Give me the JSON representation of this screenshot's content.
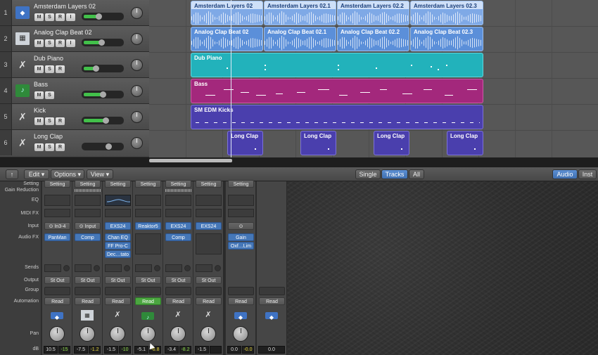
{
  "tracks": [
    {
      "num": "1",
      "name": "Amsterdam Layers 02",
      "icon": "waveform-icon",
      "buttons": [
        "M",
        "S",
        "R",
        "I"
      ]
    },
    {
      "num": "2",
      "name": "Analog Clap Beat 02",
      "icon": "drum-machine-icon",
      "buttons": [
        "M",
        "S",
        "R",
        "I"
      ]
    },
    {
      "num": "3",
      "name": "Dub Piano",
      "icon": "instrument-icon",
      "buttons": [
        "M",
        "S",
        "R"
      ]
    },
    {
      "num": "4",
      "name": "Bass",
      "icon": "midi-region-icon",
      "buttons": [
        "M",
        "S"
      ]
    },
    {
      "num": "5",
      "name": "Kick",
      "icon": "instrument-icon",
      "buttons": [
        "M",
        "S",
        "R"
      ]
    },
    {
      "num": "6",
      "name": "Long Clap",
      "icon": "instrument-icon",
      "buttons": [
        "M",
        "S",
        "R"
      ]
    }
  ],
  "regions": {
    "track1": [
      "Amsterdam Layers 02",
      "Amsterdam Layers 02.1",
      "Amsterdam Layers 02.2",
      "Amsterdam Layers 02.3"
    ],
    "track2": [
      "Analog Clap Beat 02",
      "Analog Clap Beat 02.1",
      "Analog Clap Beat 02.2",
      "Analog Clap Beat 02.3"
    ],
    "track3": "Dub Piano",
    "track4": "Bass",
    "track5": "SM EDM Kicks",
    "track6": [
      "Long Clap",
      "Long Clap",
      "Long Clap",
      "Long Clap"
    ]
  },
  "toolbar": {
    "edit": "Edit",
    "options": "Options",
    "view": "View",
    "single": "Single",
    "tracks": "Tracks",
    "all": "All",
    "audio": "Audio",
    "inst": "Inst"
  },
  "mixer_labels": {
    "setting": "Setting",
    "gain_reduction": "Gain Reduction",
    "eq": "EQ",
    "midi_fx": "MIDI FX",
    "input": "Input",
    "audio_fx": "Audio FX",
    "sends": "Sends",
    "output": "Output",
    "group": "Group",
    "automation": "Automation",
    "pan": "Pan",
    "db": "dB"
  },
  "strips": [
    {
      "setting": "Setting",
      "input": "In3-4",
      "fx": [
        "PanMan"
      ],
      "output": "St Out",
      "automation": "Read",
      "db": "10.5",
      "peak": "-15"
    },
    {
      "setting": "Setting",
      "input": "Input",
      "fx": [
        "Comp"
      ],
      "output": "St Out",
      "automation": "Read",
      "db": "-7.5",
      "peak": "-1.2"
    },
    {
      "setting": "Setting",
      "input": "EXS24",
      "fx": [
        "Chan EQ",
        "FF Pro-C",
        "Dec…tato"
      ],
      "output": "St Out",
      "automation": "Read",
      "db": "-1.5",
      "peak": "-10"
    },
    {
      "setting": "Setting",
      "input": "Reaktor5",
      "fx": [],
      "output": "St Out",
      "automation": "Read",
      "db": "-5.1",
      "peak": "-6.8"
    },
    {
      "setting": "Setting",
      "input": "EXS24",
      "fx": [
        "Comp"
      ],
      "output": "St Out",
      "automation": "Read",
      "db": "-3.4",
      "peak": "-8.2"
    },
    {
      "setting": "Setting",
      "input": "EXS24",
      "fx": [],
      "output": "St Out",
      "automation": "Read",
      "db": "-1.5",
      "peak": ""
    },
    {
      "setting": "Setting",
      "input": "",
      "fx": [
        "Gain",
        "Oxf…Lim"
      ],
      "output": "",
      "automation": "Read",
      "db": "0.0",
      "peak": "-0.0"
    },
    {
      "setting": "",
      "input": "",
      "fx": [],
      "output": "",
      "automation": "Read",
      "db": "0.0",
      "peak": ""
    }
  ]
}
